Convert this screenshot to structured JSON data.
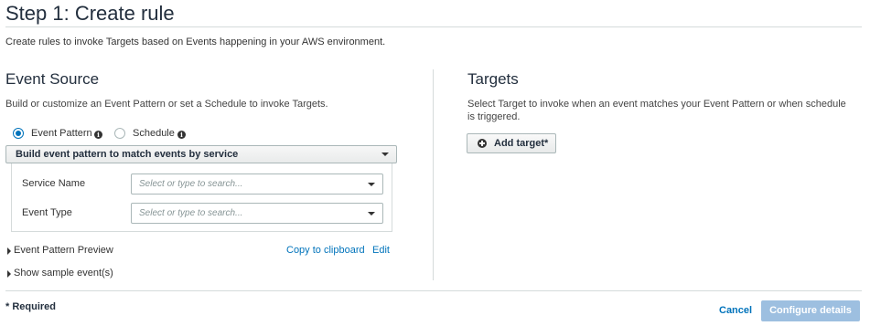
{
  "page": {
    "title": "Step 1: Create rule",
    "intro": "Create rules to invoke Targets based on Events happening in your AWS environment."
  },
  "event_source": {
    "heading": "Event Source",
    "description": "Build or customize an Event Pattern or set a Schedule to invoke Targets.",
    "options": [
      {
        "label": "Event Pattern",
        "selected": true
      },
      {
        "label": "Schedule",
        "selected": false
      }
    ],
    "pattern_dropdown": "Build event pattern to match events by service",
    "fields": {
      "service_name": {
        "label": "Service Name",
        "placeholder": "Select or type to search..."
      },
      "event_type": {
        "label": "Event Type",
        "placeholder": "Select or type to search..."
      }
    },
    "preview_label": "Event Pattern Preview",
    "copy_link": "Copy to clipboard",
    "edit_link": "Edit",
    "sample_events": "Show sample event(s)"
  },
  "targets": {
    "heading": "Targets",
    "description": "Select Target to invoke when an event matches your Event Pattern or when schedule is triggered.",
    "add_button": "Add target*"
  },
  "footer": {
    "required": "* Required",
    "cancel": "Cancel",
    "configure": "Configure details"
  },
  "colors": {
    "accent": "#0073bb",
    "primary_disabled": "#9dbfe0",
    "heading": "#232f3e"
  }
}
